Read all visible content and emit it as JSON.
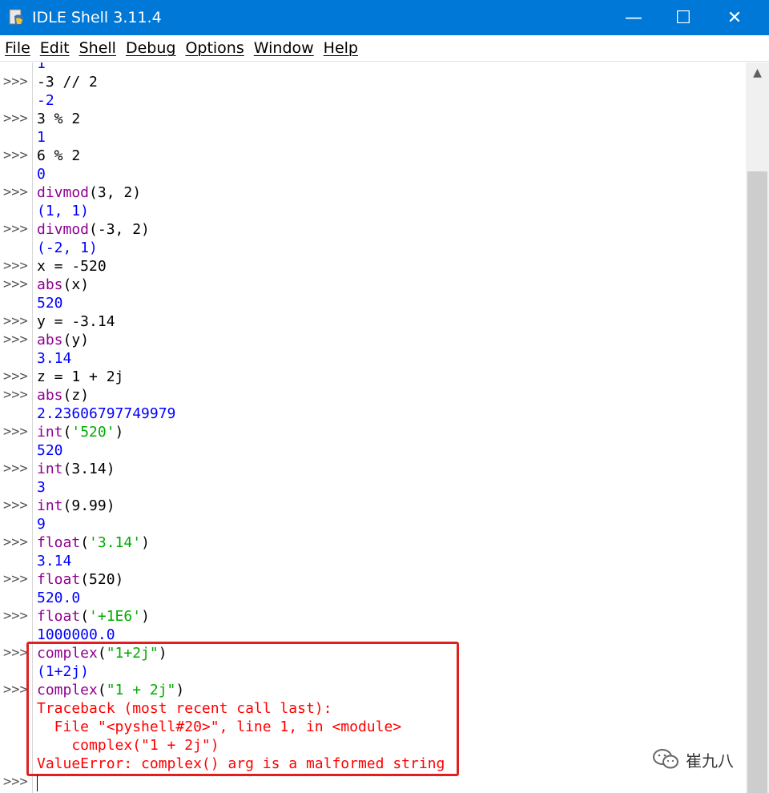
{
  "window": {
    "title": "IDLE Shell 3.11.4"
  },
  "menu": [
    "File",
    "Edit",
    "Shell",
    "Debug",
    "Options",
    "Window",
    "Help"
  ],
  "controls": {
    "minimize": "—",
    "maximize": "☐",
    "close": "✕"
  },
  "prompt": ">>>",
  "shell": [
    {
      "prompt": false,
      "segments": [
        {
          "t": "1",
          "c": "out"
        }
      ]
    },
    {
      "prompt": true,
      "segments": [
        {
          "t": "-3 // 2",
          "c": "in"
        }
      ]
    },
    {
      "prompt": false,
      "segments": [
        {
          "t": "-2",
          "c": "out"
        }
      ]
    },
    {
      "prompt": true,
      "segments": [
        {
          "t": "3 % 2",
          "c": "in"
        }
      ]
    },
    {
      "prompt": false,
      "segments": [
        {
          "t": "1",
          "c": "out"
        }
      ]
    },
    {
      "prompt": true,
      "segments": [
        {
          "t": "6 % 2",
          "c": "in"
        }
      ]
    },
    {
      "prompt": false,
      "segments": [
        {
          "t": "0",
          "c": "out"
        }
      ]
    },
    {
      "prompt": true,
      "segments": [
        {
          "t": "divmod",
          "c": "kw"
        },
        {
          "t": "(3, 2)",
          "c": "in"
        }
      ]
    },
    {
      "prompt": false,
      "segments": [
        {
          "t": "(1, 1)",
          "c": "out"
        }
      ]
    },
    {
      "prompt": true,
      "segments": [
        {
          "t": "divmod",
          "c": "kw"
        },
        {
          "t": "(-3, 2)",
          "c": "in"
        }
      ]
    },
    {
      "prompt": false,
      "segments": [
        {
          "t": "(-2, 1)",
          "c": "out"
        }
      ]
    },
    {
      "prompt": true,
      "segments": [
        {
          "t": "x = -520",
          "c": "in"
        }
      ]
    },
    {
      "prompt": true,
      "segments": [
        {
          "t": "abs",
          "c": "kw"
        },
        {
          "t": "(x)",
          "c": "in"
        }
      ]
    },
    {
      "prompt": false,
      "segments": [
        {
          "t": "520",
          "c": "out"
        }
      ]
    },
    {
      "prompt": true,
      "segments": [
        {
          "t": "y = -3.14",
          "c": "in"
        }
      ]
    },
    {
      "prompt": true,
      "segments": [
        {
          "t": "abs",
          "c": "kw"
        },
        {
          "t": "(y)",
          "c": "in"
        }
      ]
    },
    {
      "prompt": false,
      "segments": [
        {
          "t": "3.14",
          "c": "out"
        }
      ]
    },
    {
      "prompt": true,
      "segments": [
        {
          "t": "z = 1 + 2j",
          "c": "in"
        }
      ]
    },
    {
      "prompt": true,
      "segments": [
        {
          "t": "abs",
          "c": "kw"
        },
        {
          "t": "(z)",
          "c": "in"
        }
      ]
    },
    {
      "prompt": false,
      "segments": [
        {
          "t": "2.23606797749979",
          "c": "out"
        }
      ]
    },
    {
      "prompt": true,
      "segments": [
        {
          "t": "int",
          "c": "kw"
        },
        {
          "t": "(",
          "c": "in"
        },
        {
          "t": "'520'",
          "c": "str"
        },
        {
          "t": ")",
          "c": "in"
        }
      ]
    },
    {
      "prompt": false,
      "segments": [
        {
          "t": "520",
          "c": "out"
        }
      ]
    },
    {
      "prompt": true,
      "segments": [
        {
          "t": "int",
          "c": "kw"
        },
        {
          "t": "(3.14)",
          "c": "in"
        }
      ]
    },
    {
      "prompt": false,
      "segments": [
        {
          "t": "3",
          "c": "out"
        }
      ]
    },
    {
      "prompt": true,
      "segments": [
        {
          "t": "int",
          "c": "kw"
        },
        {
          "t": "(9.99)",
          "c": "in"
        }
      ]
    },
    {
      "prompt": false,
      "segments": [
        {
          "t": "9",
          "c": "out"
        }
      ]
    },
    {
      "prompt": true,
      "segments": [
        {
          "t": "float",
          "c": "kw"
        },
        {
          "t": "(",
          "c": "in"
        },
        {
          "t": "'3.14'",
          "c": "str"
        },
        {
          "t": ")",
          "c": "in"
        }
      ]
    },
    {
      "prompt": false,
      "segments": [
        {
          "t": "3.14",
          "c": "out"
        }
      ]
    },
    {
      "prompt": true,
      "segments": [
        {
          "t": "float",
          "c": "kw"
        },
        {
          "t": "(520)",
          "c": "in"
        }
      ]
    },
    {
      "prompt": false,
      "segments": [
        {
          "t": "520.0",
          "c": "out"
        }
      ]
    },
    {
      "prompt": true,
      "segments": [
        {
          "t": "float",
          "c": "kw"
        },
        {
          "t": "(",
          "c": "in"
        },
        {
          "t": "'+1E6'",
          "c": "str"
        },
        {
          "t": ")",
          "c": "in"
        }
      ]
    },
    {
      "prompt": false,
      "segments": [
        {
          "t": "1000000.0",
          "c": "out"
        }
      ]
    },
    {
      "prompt": true,
      "segments": [
        {
          "t": "complex",
          "c": "kw"
        },
        {
          "t": "(",
          "c": "in"
        },
        {
          "t": "\"1+2j\"",
          "c": "str"
        },
        {
          "t": ")",
          "c": "in"
        }
      ]
    },
    {
      "prompt": false,
      "segments": [
        {
          "t": "(1+2j)",
          "c": "out"
        }
      ]
    },
    {
      "prompt": true,
      "segments": [
        {
          "t": "complex",
          "c": "kw"
        },
        {
          "t": "(",
          "c": "in"
        },
        {
          "t": "\"1 + 2j\"",
          "c": "str"
        },
        {
          "t": ")",
          "c": "in"
        }
      ]
    },
    {
      "prompt": false,
      "segments": [
        {
          "t": "Traceback (most recent call last):",
          "c": "err"
        }
      ]
    },
    {
      "prompt": false,
      "segments": [
        {
          "t": "  File \"<pyshell#20>\", line 1, in <module>",
          "c": "err"
        }
      ]
    },
    {
      "prompt": false,
      "segments": [
        {
          "t": "    complex(\"1 + 2j\")",
          "c": "err"
        }
      ]
    },
    {
      "prompt": false,
      "segments": [
        {
          "t": "ValueError: complex() arg is a malformed string",
          "c": "err"
        }
      ]
    },
    {
      "prompt": true,
      "segments": []
    }
  ],
  "watermark": {
    "text": "崔九八"
  },
  "colors": {
    "titlebar": "#0078d7",
    "output": "#0000ff",
    "builtin": "#900090",
    "string": "#00aa00",
    "error": "#ff0000",
    "highlight": "#e02020"
  }
}
